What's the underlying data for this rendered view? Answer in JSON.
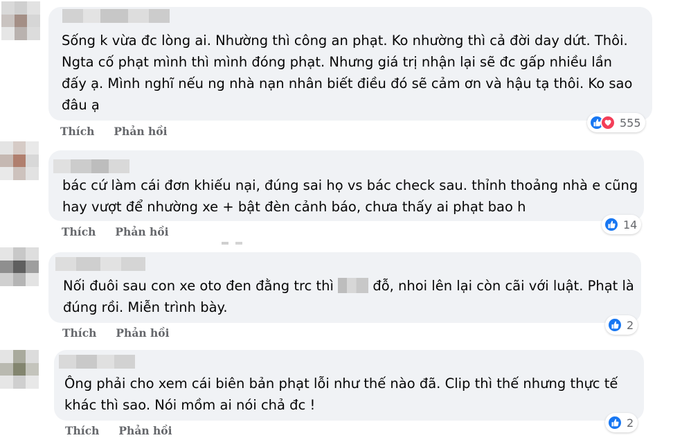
{
  "actions": {
    "like_label": "Thích",
    "reply_label": "Phản hồi"
  },
  "comments": [
    {
      "lines": [
        "Sống k vừa đc lòng ai. Nhường thì công an phạt. Ko nhường thì cả đời day dứt. Thôi.",
        "Ngta cố phạt mình thì mình đóng phạt. Nhưng giá trị nhận lại sẽ đc gấp nhiều lần",
        "đấy ạ. Mình nghĩ nếu ng nhà nạn nhân biết điều đó sẽ cảm ơn và hậu tạ thôi. Ko sao",
        "đâu ạ"
      ],
      "reaction_icons": [
        "like-icon",
        "love-icon"
      ],
      "reaction_count": "555"
    },
    {
      "lines": [
        "bác cứ làm cái đơn khiếu nại, đúng sai họ vs bác check sau. thỉnh thoảng nhà e cũng",
        "hay vượt để nhường xe + bật đèn cảnh báo, chưa thấy ai phạt bao h"
      ],
      "reaction_icons": [
        "like-icon"
      ],
      "reaction_count": "14"
    },
    {
      "lines_parts": {
        "line1_before": "Nối đuôi sau con xe oto đen đằng trc thì",
        "line1_after": "đỗ, nhoi lên lại còn cãi với luật. Phạt là",
        "line2": "đúng rồi. Miễn trình bày."
      },
      "reaction_icons": [
        "like-icon"
      ],
      "reaction_count": "2"
    },
    {
      "lines": [
        "Ông phải cho xem cái biên bản phạt lỗi như thế nào đã. Clip thì thế nhưng thực tế",
        "khác thì sao. Nói mồm ai nói chả đc !"
      ],
      "reaction_icons": [
        "like-icon"
      ],
      "reaction_count": "2"
    }
  ],
  "colors": {
    "bubble": "#f0f2f5",
    "like_blue": "#1877f2",
    "love_red": "#f33e58",
    "meta_gray": "#65676b"
  }
}
